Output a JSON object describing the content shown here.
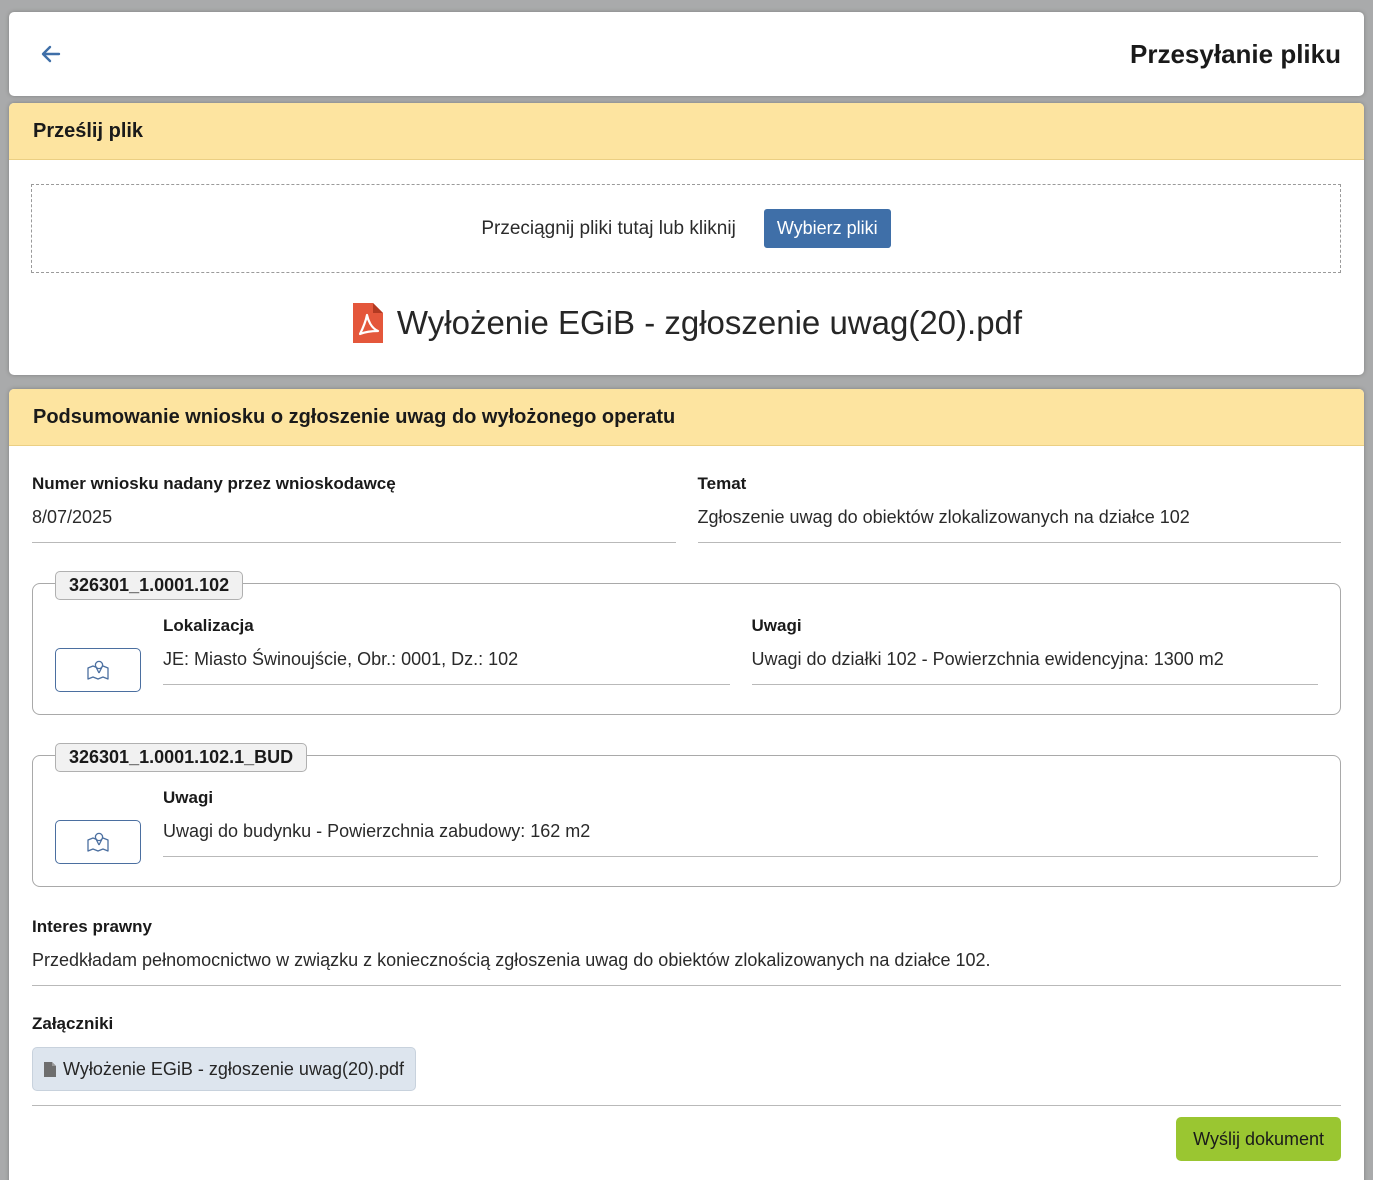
{
  "header": {
    "title": "Przesyłanie pliku"
  },
  "upload": {
    "section_title": "Prześlij plik",
    "drop_text": "Przeciągnij pliki tutaj lub kliknij",
    "choose_button": "Wybierz pliki",
    "file_name": "Wyłożenie EGiB - zgłoszenie uwag(20).pdf"
  },
  "summary": {
    "section_title": "Podsumowanie wniosku o zgłoszenie uwag do wyłożonego operatu",
    "request_number_label": "Numer wniosku nadany przez wnioskodawcę",
    "request_number_value": "8/07/2025",
    "subject_label": "Temat",
    "subject_value": "Zgłoszenie uwag do obiektów zlokalizowanych na działce 102",
    "objects": [
      {
        "id": "326301_1.0001.102",
        "location_label": "Lokalizacja",
        "location_value": "JE: Miasto Świnoujście, Obr.: 0001, Dz.: 102",
        "remarks_label": "Uwagi",
        "remarks_value": "Uwagi do działki 102 - Powierzchnia ewidencyjna: 1300 m2"
      },
      {
        "id": "326301_1.0001.102.1_BUD",
        "remarks_label": "Uwagi",
        "remarks_value": "Uwagi do budynku - Powierzchnia zabudowy: 162 m2"
      }
    ],
    "legal_interest_label": "Interes prawny",
    "legal_interest_value": "Przedkładam pełnomocnictwo w związku z koniecznością zgłoszenia uwag do obiektów zlokalizowanych na działce 102.",
    "attachments_label": "Załączniki",
    "attachments": [
      "Wyłożenie EGiB - zgłoszenie uwag(20).pdf"
    ],
    "send_button": "Wyślij dokument"
  },
  "colors": {
    "section_header_bg": "#fde4a0",
    "primary_button": "#3f6fa8",
    "send_button": "#9ac631",
    "pdf_icon": "#e4573b"
  },
  "icons": [
    "back-arrow-icon",
    "pdf-file-icon",
    "map-locate-icon",
    "document-icon"
  ]
}
